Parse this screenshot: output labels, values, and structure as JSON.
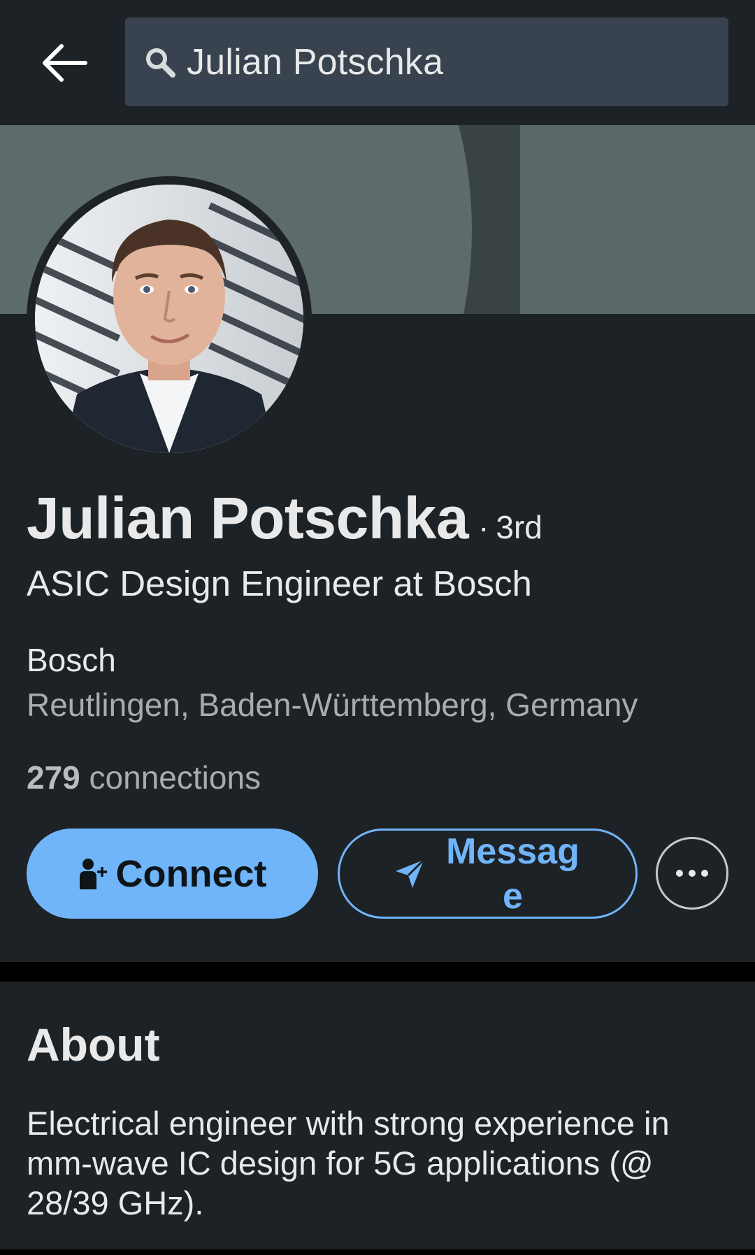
{
  "search": {
    "query": "Julian Potschka"
  },
  "profile": {
    "name": "Julian Potschka",
    "degree_separator": "·",
    "degree": "3rd",
    "headline": "ASIC Design Engineer at Bosch",
    "company": "Bosch",
    "location": "Reutlingen, Baden-Württemberg, Germany",
    "connections_count": "279",
    "connections_label": "connections"
  },
  "actions": {
    "connect_label": "Connect",
    "message_label": "Message"
  },
  "about": {
    "title": "About",
    "text": "Electrical engineer with strong experience in mm-wave IC design for 5G applications (@ 28/39 GHz)."
  },
  "colors": {
    "background": "#1d2226",
    "search_box": "#38434f",
    "accent": "#70b5f9",
    "secondary_text": "#a7acb0"
  },
  "icons": {
    "back": "arrow-left-icon",
    "search": "search-icon",
    "connect": "person-add-icon",
    "message": "send-icon",
    "more": "more-horizontal-icon"
  }
}
